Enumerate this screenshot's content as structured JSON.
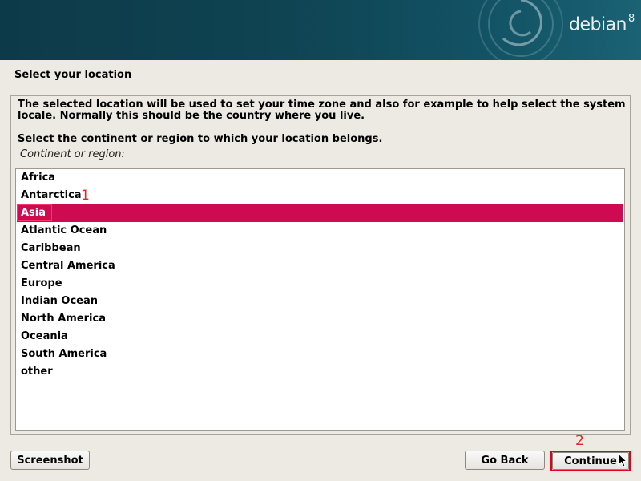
{
  "header": {
    "brand_name": "debian",
    "brand_version": "8"
  },
  "page": {
    "title": "Select your location",
    "description": "The selected location will be used to set your time zone and also for example to help select the system locale. Normally this should be the country where you live.",
    "prompt": "Select the continent or region to which your location belongs.",
    "field_label": "Continent or region:"
  },
  "regions": {
    "items": [
      {
        "label": "Africa"
      },
      {
        "label": "Antarctica"
      },
      {
        "label": "Asia"
      },
      {
        "label": "Atlantic Ocean"
      },
      {
        "label": "Caribbean"
      },
      {
        "label": "Central America"
      },
      {
        "label": "Europe"
      },
      {
        "label": "Indian Ocean"
      },
      {
        "label": "North America"
      },
      {
        "label": "Oceania"
      },
      {
        "label": "South America"
      },
      {
        "label": "other"
      }
    ],
    "selected": "Asia"
  },
  "annotations": {
    "marker_1": "1",
    "marker_2": "2"
  },
  "buttons": {
    "screenshot": "Screenshot",
    "go_back": "Go Back",
    "continue": "Continue"
  },
  "colors": {
    "selection": "#ce0a51",
    "annotation": "#e3001b",
    "banner": "#0f4453"
  }
}
